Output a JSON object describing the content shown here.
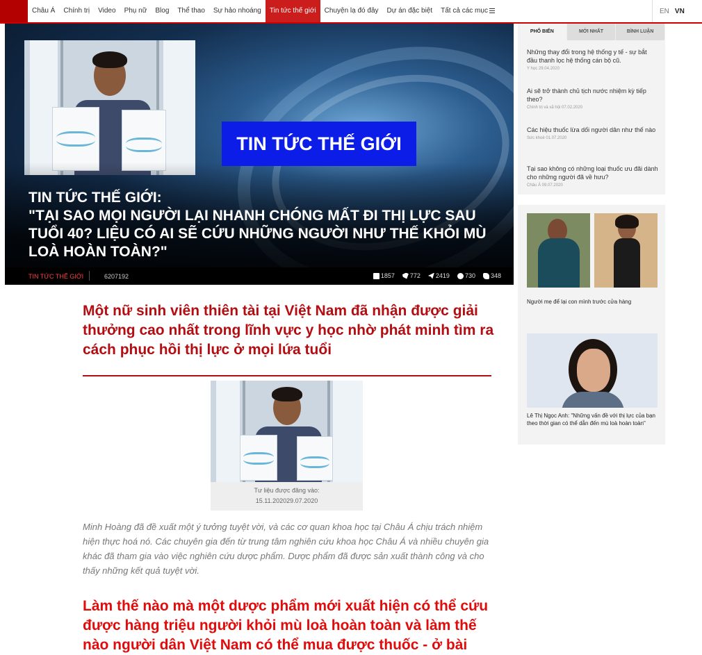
{
  "nav": {
    "items": [
      "Châu Á",
      "Chính trị",
      "Video",
      "Phụ nữ",
      "Blog",
      "Thể thao",
      "Sự hảo nhoáng",
      "Tin tức thế giới",
      "Chuyện lạ đó đây",
      "Dự án đặc biệt",
      "Tất cả các mục"
    ],
    "active_index": 7,
    "lang_en": "EN",
    "lang_vn": "VN"
  },
  "hero": {
    "badge": "TIN TỨC THẾ GIỚI",
    "title": "TIN TỨC THẾ GIỚI:\n\"TẠI SAO MỌI NGƯỜI LẠI NHANH CHÓNG MẤT ĐI THỊ LỰC SAU TUỔI 40? LIỆU CÓ AI SẼ CỨU NHỮNG NGƯỜI NHƯ THẾ KHỎI MÙ LOÀ HOÀN TOÀN?\"",
    "category": "TIN TỨC THẾ GIỚI",
    "views": "6207192",
    "social": {
      "facebook": "1857",
      "twitter": "772",
      "telegram": "2419",
      "messenger": "730",
      "phone": "348"
    }
  },
  "article": {
    "headline": "Một nữ sinh viên thiên tài tại Việt Nam đã nhận được giải thưởng cao nhất trong lĩnh vực y học nhờ phát minh tìm ra cách phục hồi thị lực ở mọi lứa tuổi",
    "caption_line1": "Tư liệu được đăng vào:",
    "caption_line2": "15.11.202029.07.2020",
    "body": "Minh Hoàng đã đề xuất một ý tưởng tuyệt vời, và các cơ quan khoa học tại Châu Á chịu trách nhiệm hiện thực hoá nó. Các chuyên gia đến từ trung tâm nghiên cứu khoa học Châu Á và nhiều chuyên gia khác đã tham gia vào việc nghiên cứu dược phẩm. Dược phẩm đã được sản xuất thành công và cho thấy những kết quả tuyệt vời.",
    "subhead": "Làm thế nào mà một dược phẩm mới xuất hiện có thể cứu được hàng triệu người khỏi mù loà hoàn toàn và làm thế nào người dân Việt Nam có thể mua được thuốc - ở bài"
  },
  "sidebar": {
    "tabs": [
      "PHỔ BIẾN",
      "MỚI NHẤT",
      "BÌNH LUẬN"
    ],
    "items": [
      {
        "title": "Những thay đổi trong hệ thống y tế - sự bắt đầu thanh lọc hệ thống cán bộ cũ.",
        "meta": "Y học   29.04.2020"
      },
      {
        "title": "Ai sẽ trở thành chủ tịch nước nhiệm kỳ tiếp theo?",
        "meta": "Chính trị và xã hội   07.02.2020"
      },
      {
        "title": "Các hiệu thuốc lừa dối người dân như thế nào",
        "meta": "Sức khoẻ   01.07.2020"
      },
      {
        "title": "Tại sao không có những loại thuốc ưu đãi dành cho những người đã về hưu?",
        "meta": "Châu Á   09.07.2020"
      }
    ],
    "card1_caption": "Người mẹ để lại con mình trước cửa hàng",
    "card2_caption": "Lê Thị Ngọc Anh: \"Những vấn đề với thị lực của bạn theo thời gian có thể dẫn đến mù loà hoàn toàn\""
  },
  "colors": {
    "brand_red": "#b30d12",
    "accent_red": "#e00c0c",
    "badge_blue": "#0b1de6"
  }
}
